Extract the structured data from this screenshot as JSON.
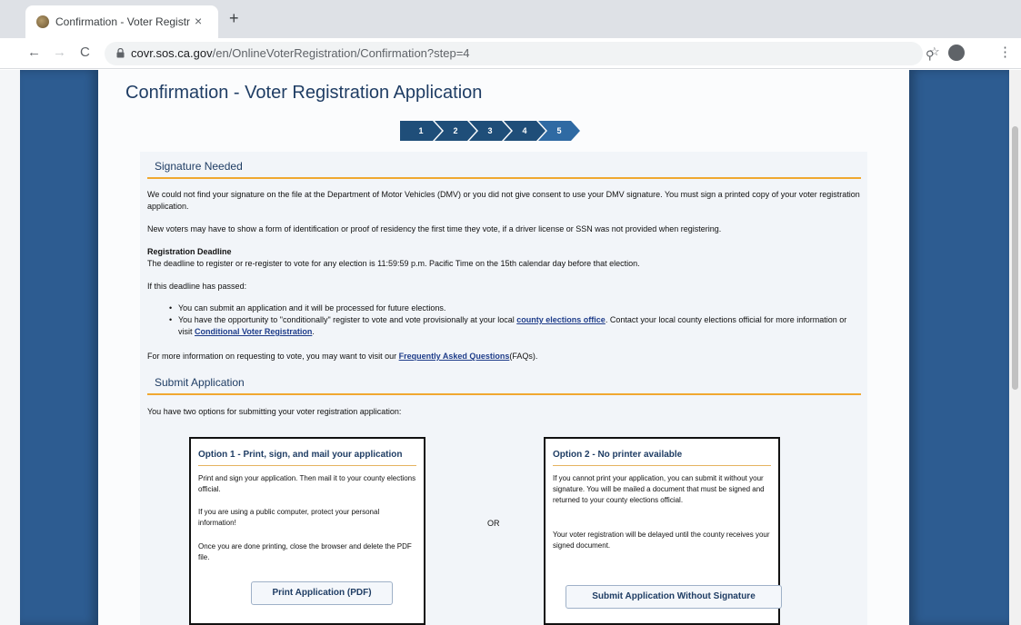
{
  "browser": {
    "tab_title": "Confirmation - Voter Registrati",
    "tab_close": "×",
    "new_tab": "+",
    "back": "←",
    "forward": "→",
    "reload": "C",
    "url_host": "covr.sos.ca.gov",
    "url_path": "/en/OnlineVoterRegistration/Confirmation?step=4",
    "zoom": "⚲",
    "star": "☆",
    "menu": "⋮"
  },
  "page": {
    "title": "Confirmation - Voter Registration Application",
    "steps": [
      "1",
      "2",
      "3",
      "4",
      "5"
    ],
    "active_step": "5"
  },
  "signature": {
    "heading": "Signature Needed",
    "p1": "We could not find your signature on the file at the Department of Motor Vehicles (DMV) or you did not give consent to use your DMV signature. You must sign a printed copy of your voter registration application.",
    "p2": "New voters may have to show a form of identification or proof of residency the first time they vote, if a driver license or SSN was not provided when registering.",
    "deadline_label": "Registration Deadline",
    "deadline_text": "The deadline to register or re-register to vote for any election is 11:59:59 p.m. Pacific Time on the 15th calendar day before that election.",
    "passed": "If this deadline has passed:",
    "bullet1": "You can submit an application and it will be processed for future elections.",
    "bullet2_a": "You have the opportunity to \"conditionally\" register to vote and vote provisionally at your local ",
    "bullet2_link1": "county elections office",
    "bullet2_b": ". Contact your local county elections official for more information or visit ",
    "bullet2_link2": "Conditional Voter Registration",
    "bullet2_c": ".",
    "faq_a": "For more information on requesting to vote, you may want to visit our ",
    "faq_link": "Frequently Asked Questions",
    "faq_b": "(FAQs)."
  },
  "submit": {
    "heading": "Submit Application",
    "intro": "You have two options for submitting your voter registration application:",
    "or": "OR",
    "option1": {
      "title": "Option 1 - Print, sign, and mail your application",
      "t1": "Print and sign your application. Then mail it to your county elections official.",
      "t2": "If you are using a public computer, protect your personal information!",
      "t3": "Once you are done printing, close the browser and delete the PDF file.",
      "button": "Print Application (PDF)"
    },
    "option2": {
      "title": "Option 2 - No printer available",
      "t1": "If you cannot print your application, you can submit it without your signature. You will be mailed a document that must be signed and returned to your county elections official.",
      "t2": "Your voter registration will be delayed until the county receives your signed document.",
      "button": "Submit Application Without Signature"
    }
  }
}
